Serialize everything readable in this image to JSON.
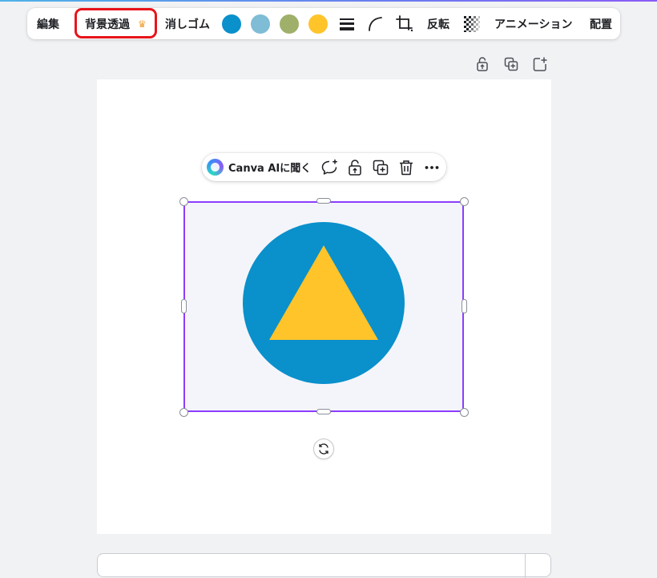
{
  "toolbar": {
    "edit_label": "編集",
    "bg_remove_label": "背景透過",
    "bg_remove_badge_icon": "crown-icon",
    "eraser_label": "消しゴム",
    "colors": [
      "#0a90cb",
      "#7fbcd5",
      "#9fb06a",
      "#fec42a"
    ],
    "flip_label": "反転",
    "animation_label": "アニメーション",
    "position_label": "配置",
    "icons": [
      "border-style-icon",
      "corner-rounding-icon",
      "crop-icon",
      "transparency-icon"
    ]
  },
  "page_actions": {
    "icons": [
      "lock-icon",
      "duplicate-page-icon",
      "add-page-icon"
    ]
  },
  "context_toolbar": {
    "ai_label": "Canva AIに聞く",
    "icons": [
      "comment-add-icon",
      "lock-icon",
      "duplicate-icon",
      "trash-icon",
      "more-icon"
    ]
  },
  "element": {
    "circle_color": "#0a90cb",
    "triangle_color": "#fec42a",
    "selection_color": "#8b3dff"
  }
}
